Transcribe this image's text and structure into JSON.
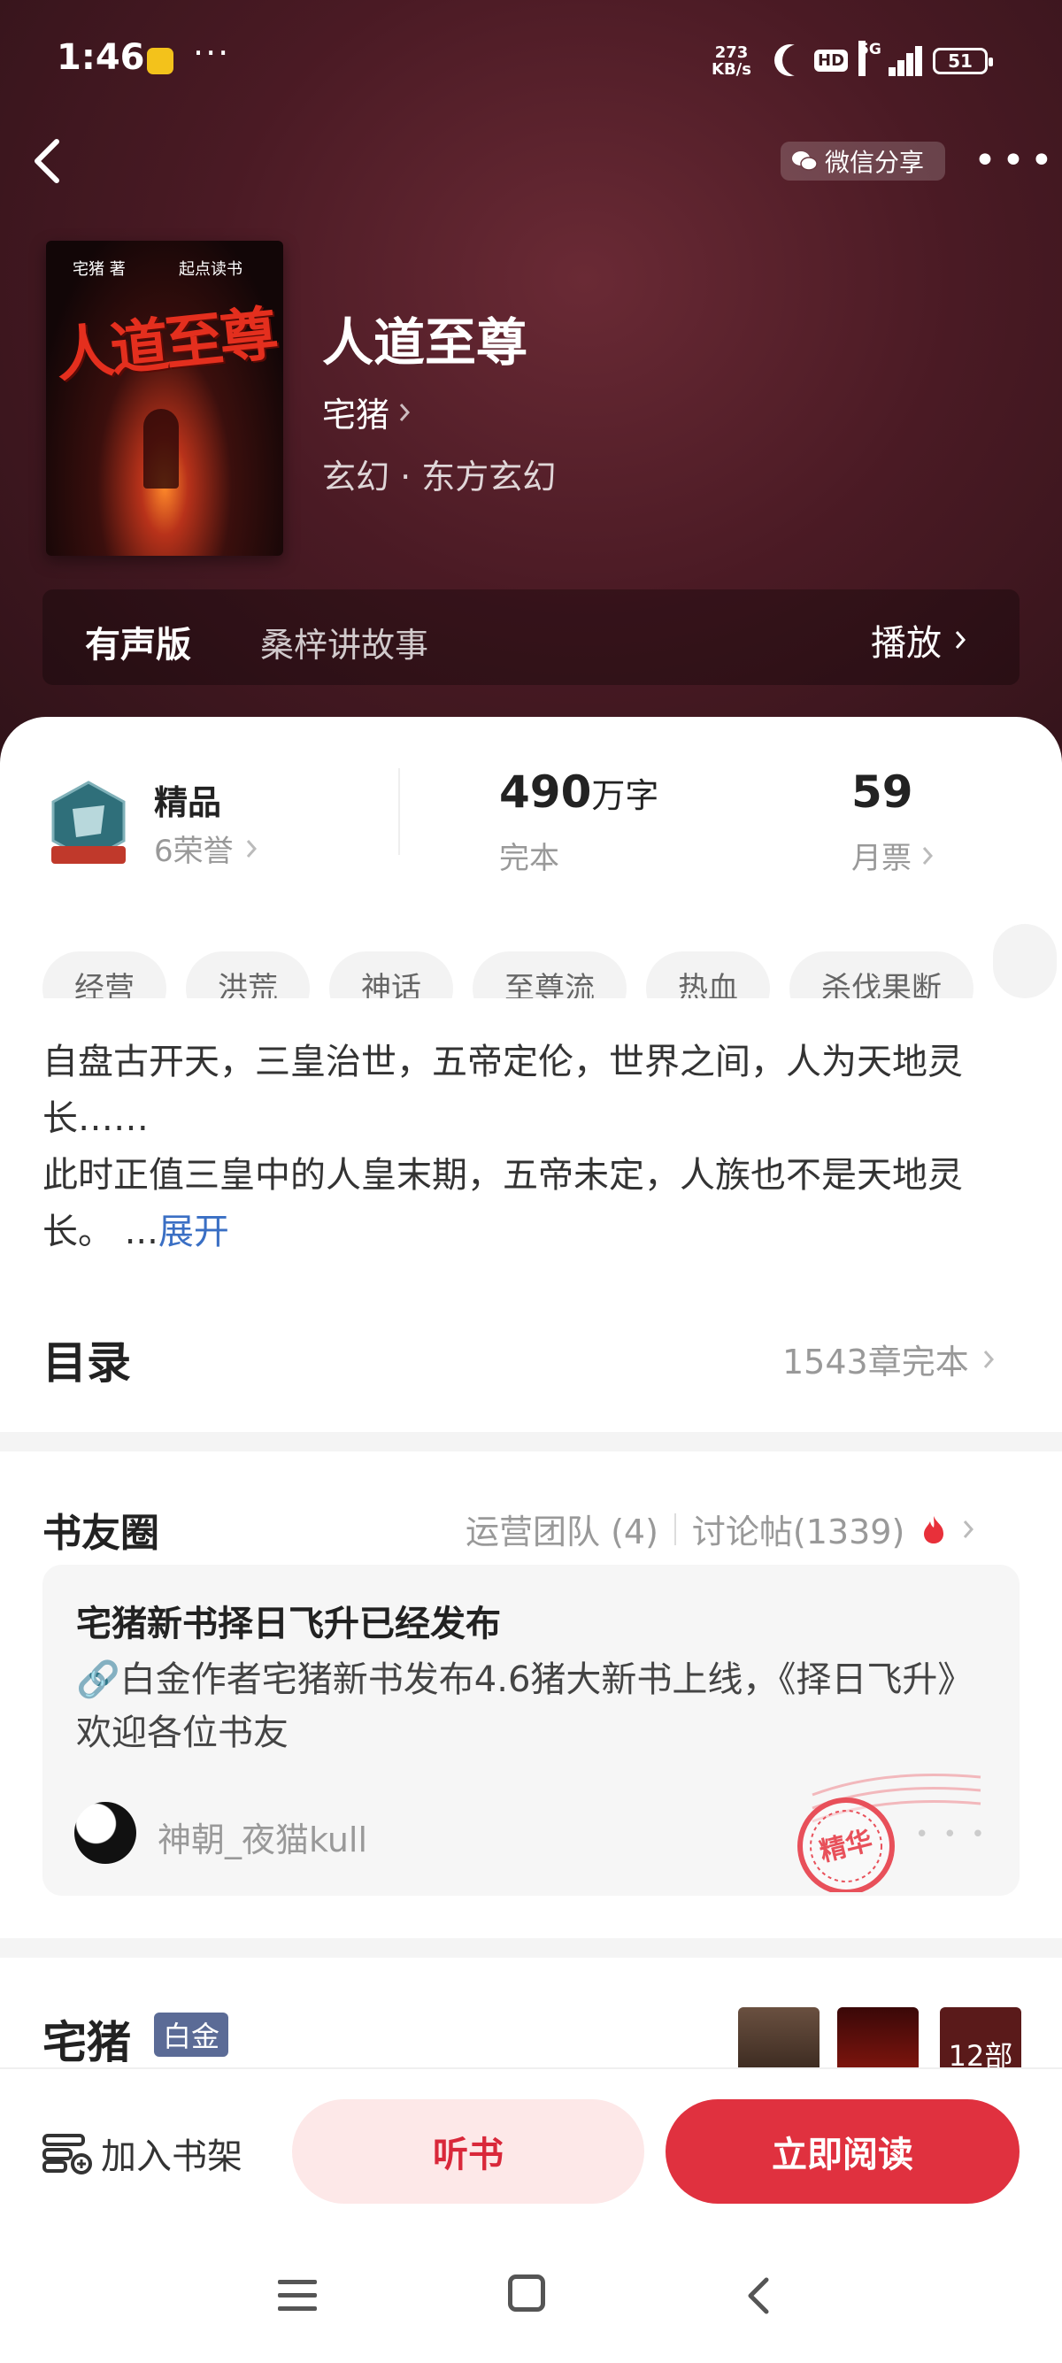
{
  "status_bar": {
    "time": "1:46",
    "dots": "···",
    "net_speed_value": "273",
    "net_speed_unit": "KB/s",
    "hd": "HD",
    "network": "5G",
    "battery": "51"
  },
  "nav": {
    "share_label": "微信分享",
    "more": "•••"
  },
  "book": {
    "cover_author": "宅猪 著",
    "cover_publisher": "起点读书",
    "cover_title": "人道至尊",
    "title": "人道至尊",
    "author": "宅猪",
    "category": "玄幻 · 东方玄幻"
  },
  "audio": {
    "label": "有声版",
    "narrator": "桑梓讲故事",
    "play_label": "播放"
  },
  "stats": {
    "badge_title": "精品",
    "badge_sub": "6荣誉",
    "words_value": "490",
    "words_unit": "万字",
    "words_status": "完本",
    "votes_value": "59",
    "votes_label": "月票"
  },
  "tags": [
    "经营",
    "洪荒",
    "神话",
    "至尊流",
    "热血",
    "杀伐果断",
    ""
  ],
  "intro": {
    "line1": "自盘古开天，三皇治世，五帝定伦，世界之间，人为天地灵长……",
    "line2": "此时正值三皇中的人皇末期，五帝未定，人族也不是天地灵长。",
    "ellipsis": "...",
    "expand": "展开"
  },
  "toc": {
    "title": "目录",
    "count": "1543章完本"
  },
  "circle": {
    "title": "书友圈",
    "team": "运营团队 (4)",
    "posts": "讨论帖(1339)",
    "post_title": "宅猪新书择日飞升已经发布",
    "post_body": "🔗白金作者宅猪新书发布4.6猪大新书上线，《择日飞升》欢迎各位书友",
    "post_user": "神朝_夜猫kull",
    "stamp": "精华"
  },
  "author_section": {
    "name": "宅猪",
    "level": "白金",
    "more_books": "12部"
  },
  "actions": {
    "shelf": "加入书架",
    "listen": "听书",
    "read": "立即阅读"
  },
  "colors": {
    "hero": "#4a1a24",
    "accent_red": "#e0313f",
    "expand_link": "#3a6fc4"
  }
}
